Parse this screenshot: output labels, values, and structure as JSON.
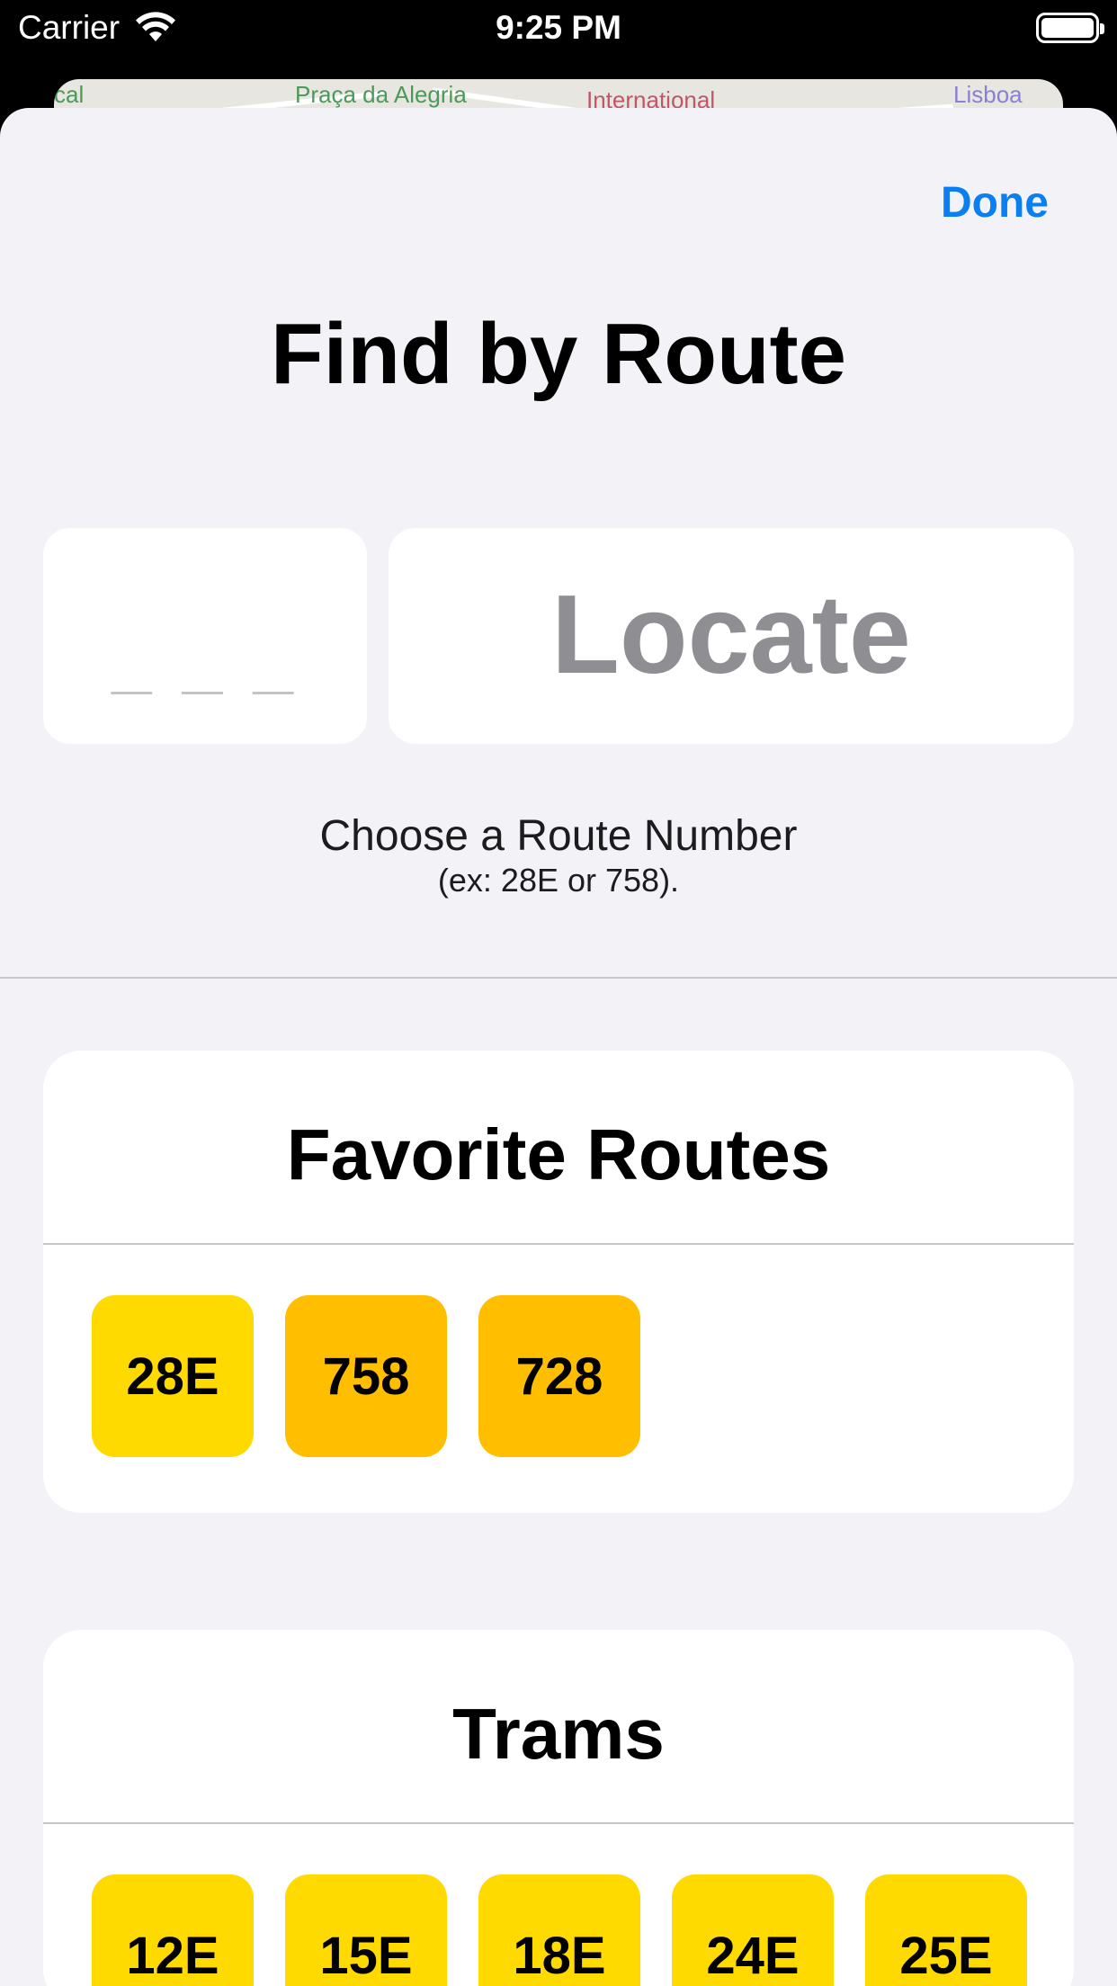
{
  "status_bar": {
    "carrier": "Carrier",
    "time": "9:25 PM"
  },
  "map_peek": {
    "labels": [
      "cal",
      "Praça da Alegria",
      "International",
      "Lisboa"
    ]
  },
  "header": {
    "done_label": "Done",
    "title": "Find by Route"
  },
  "route_input": {
    "placeholder": "_ _ _"
  },
  "locate_button": {
    "label": "Locate"
  },
  "hint": {
    "main": "Choose a Route Number",
    "sub": "(ex: 28E or 758)."
  },
  "favorites": {
    "title": "Favorite Routes",
    "routes": [
      {
        "label": "28E",
        "color": "#FFDA00"
      },
      {
        "label": "758",
        "color": "#FFBF00"
      },
      {
        "label": "728",
        "color": "#FFBF00"
      }
    ]
  },
  "trams": {
    "title": "Trams",
    "routes": [
      {
        "label": "12E",
        "color": "#FFDA00"
      },
      {
        "label": "15E",
        "color": "#FFDA00"
      },
      {
        "label": "18E",
        "color": "#FFDA00"
      },
      {
        "label": "24E",
        "color": "#FFDA00"
      },
      {
        "label": "25E",
        "color": "#FFDA00"
      }
    ]
  },
  "colors": {
    "accent": "#0A7FF2",
    "sheet_background": "#F2F2F7",
    "tram_yellow": "#FFDA00",
    "bus_amber": "#FFBF00"
  }
}
